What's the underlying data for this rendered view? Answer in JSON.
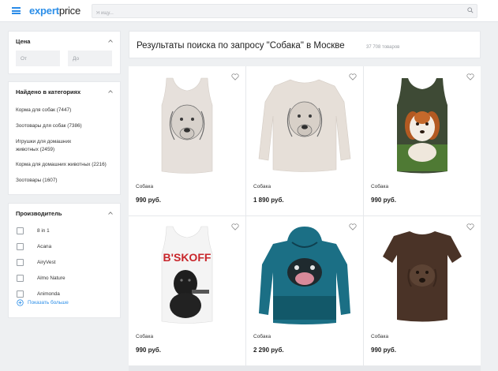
{
  "header": {
    "logo_part1": "expert",
    "logo_part2": "price",
    "search_placeholder": "Я ищу...",
    "accent_color": "#2b8ee8"
  },
  "filters": {
    "price": {
      "title": "Цена",
      "from_placeholder": "От",
      "to_placeholder": "До"
    },
    "categories": {
      "title": "Найдено в категориях",
      "items": [
        {
          "label": "Корма для собак",
          "count": "(7447)"
        },
        {
          "label": "Зоотовары для собак",
          "count": "(7386)"
        },
        {
          "label": "Игрушки для домашних животных",
          "count": "(2459)"
        },
        {
          "label": "Корма для домашних животных",
          "count": "(2216)"
        },
        {
          "label": "Зоотовары",
          "count": "(1607)"
        }
      ]
    },
    "manufacturer": {
      "title": "Производитель",
      "items": [
        "8 in 1",
        "Acana",
        "AiryVest",
        "Almo Nature",
        "Animonda"
      ],
      "show_more": "Показать больше"
    }
  },
  "results": {
    "title": "Результаты поиска по запросу \"Собака\" в Москве",
    "count": "37 708 товаров",
    "products": [
      {
        "name": "Собака",
        "price": "990 руб.",
        "image": "tank-top-beagle-sketch"
      },
      {
        "name": "Собака",
        "price": "1 890 руб.",
        "image": "sweatshirt-beagle-sketch"
      },
      {
        "name": "Собака",
        "price": "990 руб.",
        "image": "tank-top-puppy-photo"
      },
      {
        "name": "Собака",
        "price": "990 руб.",
        "image": "tank-top-dog-with-gun",
        "print_text": "B'SKOFF"
      },
      {
        "name": "Собака",
        "price": "2 290 руб.",
        "image": "hoodie-underwater-dog"
      },
      {
        "name": "Собака",
        "price": "990 руб.",
        "image": "tshirt-brown-dog"
      }
    ]
  }
}
